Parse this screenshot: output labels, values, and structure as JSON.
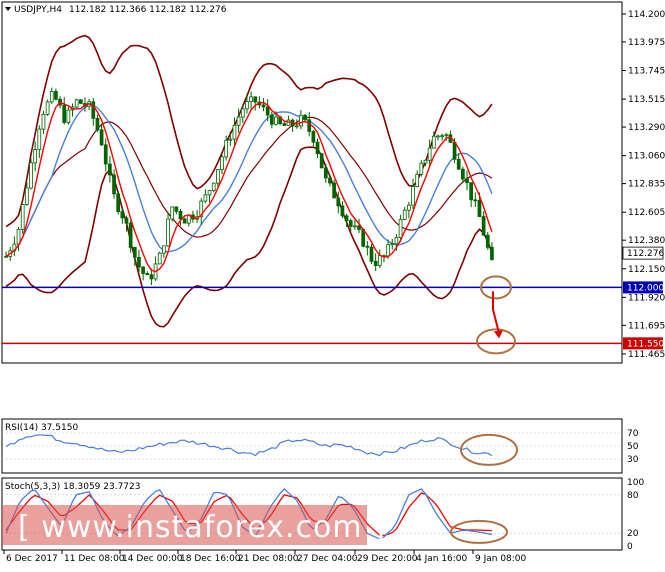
{
  "header": {
    "symbol": "USDJPY,H4",
    "ohlc": "112.182 112.366 112.182 112.276"
  },
  "rsi_label": "RSI(14) 37.5150",
  "stoch_label": "Stoch(5,3,3) 18.3059 23.7723",
  "watermark": "[ www.instaforex.com ]",
  "colors": {
    "candle": "#006400",
    "bb": "#800000",
    "ma_fast": "#ff0000",
    "ma_slow": "#4a7fd8",
    "support_line": "#0000b4",
    "target_line": "#cc0000",
    "osc": "#4a7fd8",
    "annotation": "#b07040",
    "arrow": "#e00000"
  },
  "chart_data": [
    {
      "type": "candlestick",
      "symbol": "USDJPY",
      "timeframe": "H4",
      "y_ticks": [
        "114.200",
        "113.975",
        "113.745",
        "113.515",
        "113.290",
        "113.060",
        "112.835",
        "112.605",
        "112.380",
        "112.150",
        "111.920",
        "111.695",
        "111.465"
      ],
      "ylim": [
        111.4,
        114.28
      ],
      "x_tick_labels": [
        "6 Dec 2017",
        "11 Dec 08:00",
        "14 Dec 00:00",
        "18 Dec 16:00",
        "21 Dec 08:00",
        "27 Dec 04:00",
        "29 Dec 20:00",
        "4 Jan 16:00",
        "9 Jan 08:00"
      ],
      "current_price": "112.276",
      "levels": [
        {
          "name": "support",
          "value": 112.0,
          "label": "112.000"
        },
        {
          "name": "target",
          "value": 111.55,
          "label": "111.550"
        }
      ],
      "price_path": [
        112.25,
        112.45,
        112.95,
        113.4,
        113.55,
        113.35,
        113.5,
        113.45,
        113.2,
        112.75,
        112.55,
        112.2,
        112.05,
        112.25,
        112.65,
        112.55,
        112.6,
        112.75,
        113.0,
        113.25,
        113.45,
        113.5,
        113.4,
        113.3,
        113.3,
        113.35,
        113.2,
        112.85,
        112.7,
        112.5,
        112.4,
        112.2,
        112.25,
        112.45,
        112.7,
        112.95,
        113.2,
        113.25,
        113.05,
        112.8,
        112.55,
        112.18
      ]
    },
    {
      "type": "line",
      "name": "RSI(14)",
      "value": 37.515,
      "y_ticks": [
        "70",
        "50",
        "30"
      ],
      "ylim": [
        10,
        90
      ],
      "values": [
        48,
        62,
        68,
        66,
        58,
        55,
        50,
        44,
        40,
        43,
        48,
        52,
        56,
        58,
        54,
        50,
        46,
        40,
        38,
        44,
        55,
        60,
        56,
        50,
        52,
        48,
        40,
        38,
        42,
        50,
        58,
        62,
        55,
        45,
        40,
        37.5
      ]
    },
    {
      "type": "line",
      "name": "Stoch(5,3,3)",
      "k": 18.3059,
      "d": 23.7723,
      "y_ticks": [
        "100",
        "80",
        "20",
        "0"
      ],
      "ylim": [
        0,
        100
      ],
      "k_values": [
        20,
        70,
        90,
        60,
        30,
        80,
        85,
        40,
        15,
        30,
        70,
        90,
        55,
        20,
        40,
        85,
        80,
        30,
        15,
        60,
        90,
        70,
        25,
        40,
        80,
        60,
        20,
        10,
        30,
        80,
        90,
        50,
        20,
        25,
        22,
        18
      ],
      "d_values": [
        25,
        55,
        80,
        70,
        45,
        60,
        80,
        55,
        25,
        25,
        55,
        80,
        70,
        35,
        35,
        70,
        80,
        50,
        25,
        45,
        80,
        75,
        40,
        35,
        65,
        65,
        35,
        15,
        22,
        60,
        85,
        65,
        30,
        25,
        25,
        24
      ]
    }
  ]
}
